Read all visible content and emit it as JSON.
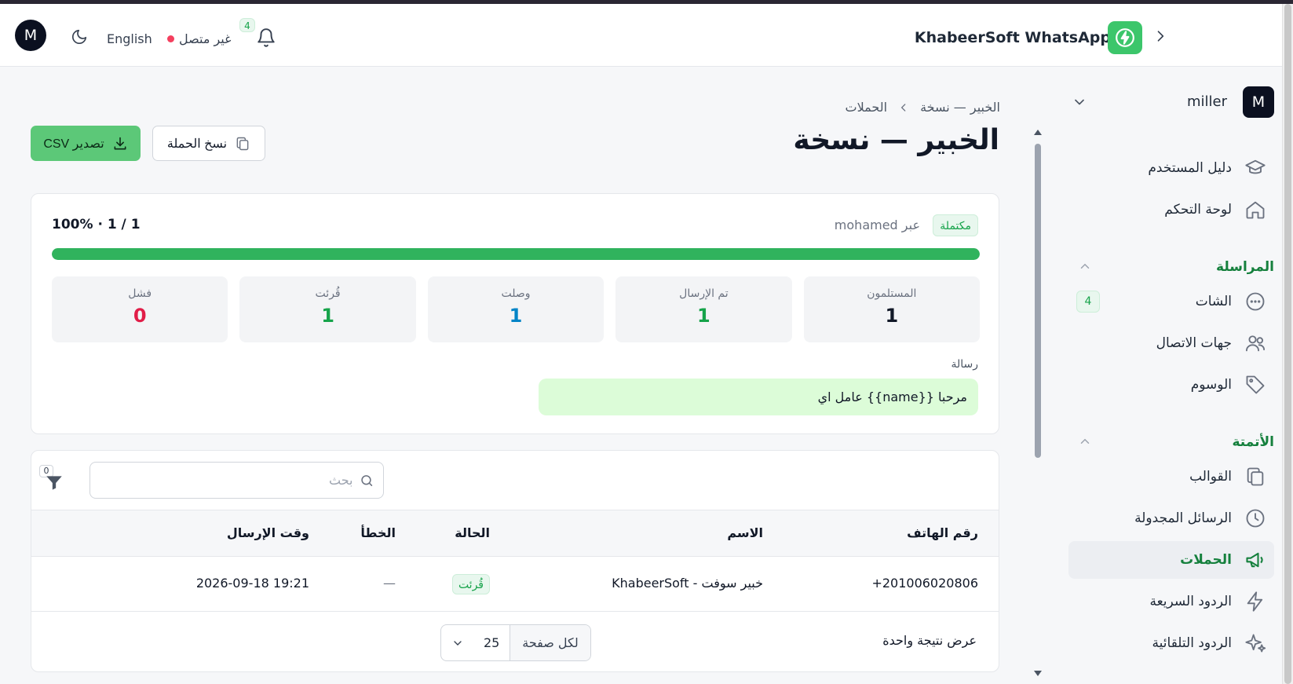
{
  "header": {
    "avatar_letter": "M",
    "language": "English",
    "connection_status": "غير متصل",
    "notifications_count": "4",
    "brand_title": "KhabeerSoft WhatsApp"
  },
  "sidebar": {
    "user": {
      "letter": "M",
      "name": "miller"
    },
    "items_top": [
      {
        "label": "دليل المستخدم",
        "icon": "graduation-cap-icon"
      },
      {
        "label": "لوحة التحكم",
        "icon": "home-icon"
      }
    ],
    "messaging_title": "المراسلة",
    "messaging_items": [
      {
        "label": "الشات",
        "icon": "chat-icon",
        "badge": "4"
      },
      {
        "label": "جهات الاتصال",
        "icon": "users-icon"
      },
      {
        "label": "الوسوم",
        "icon": "tag-icon"
      }
    ],
    "automation_title": "الأتمتة",
    "automation_items": [
      {
        "label": "القوالب",
        "icon": "copy-icon"
      },
      {
        "label": "الرسائل المجدولة",
        "icon": "clock-icon"
      },
      {
        "label": "الحملات",
        "icon": "megaphone-icon"
      },
      {
        "label": "الردود السريعة",
        "icon": "bolt-icon"
      },
      {
        "label": "الردود التلقائية",
        "icon": "sparkles-icon"
      }
    ]
  },
  "breadcrumb": {
    "parent": "الحملات",
    "current": "الخبير — نسخة"
  },
  "page_title": "الخبير — نسخة",
  "actions": {
    "copy_label": "نسخ الحملة",
    "export_label": "تصدير CSV"
  },
  "campaign": {
    "status": "مكتملة",
    "via": "عبر mohamed",
    "progress_text": "100% · 1 / 1",
    "progress_percent": 100,
    "stats": [
      {
        "label": "المستلمون",
        "value": "1",
        "color": "#111827"
      },
      {
        "label": "تم الإرسال",
        "value": "1",
        "color": "#16a34a"
      },
      {
        "label": "وصلت",
        "value": "1",
        "color": "#0284c7"
      },
      {
        "label": "قُرئت",
        "value": "1",
        "color": "#16a34a"
      },
      {
        "label": "فشل",
        "value": "0",
        "color": "#e11d48"
      }
    ],
    "message_label": "رسالة",
    "message_text": "مرحبا {{name}} عامل اي"
  },
  "table": {
    "search_placeholder": "بحث",
    "filter_count": "0",
    "columns": {
      "phone": "رقم الهاتف",
      "name": "الاسم",
      "status": "الحالة",
      "error": "الخطأ",
      "sent_at": "وقت الإرسال"
    },
    "rows": [
      {
        "phone": "+201006020806",
        "name": "خبير سوفت - KhabeerSoft",
        "status": "قُرئت",
        "error": "—",
        "sent_at": "2026-09-18 19:21"
      }
    ],
    "result_count": "عرض نتيجة واحدة",
    "per_page_label": "لكل صفحة",
    "per_page_value": "25"
  },
  "colors": {
    "accent": "#16a34a",
    "primary_button": "#5cc878"
  }
}
